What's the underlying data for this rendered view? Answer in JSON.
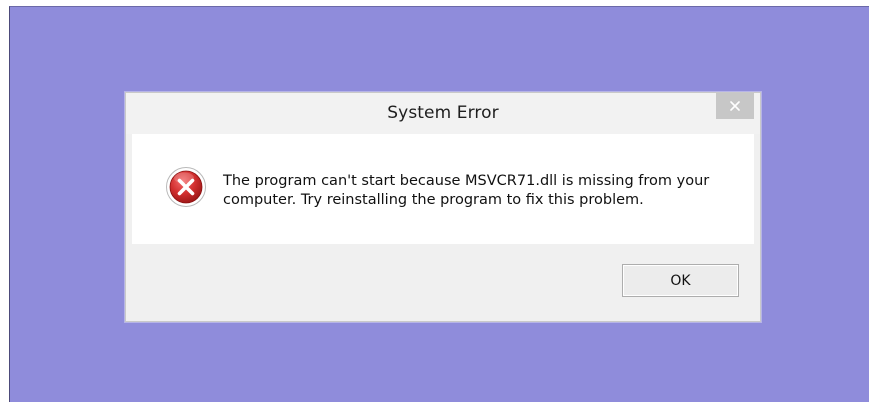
{
  "dialog": {
    "title": "System Error",
    "close_label": "×",
    "message": "The program can't start because MSVCR71.dll is missing from your computer. Try reinstalling the program to fix this problem.",
    "icon": "error-icon",
    "ok_label": "OK"
  },
  "colors": {
    "desktop_background": "#8f8cdb",
    "dialog_background": "#f0f0f0",
    "content_background": "#ffffff",
    "error_red": "#d22f2f"
  }
}
